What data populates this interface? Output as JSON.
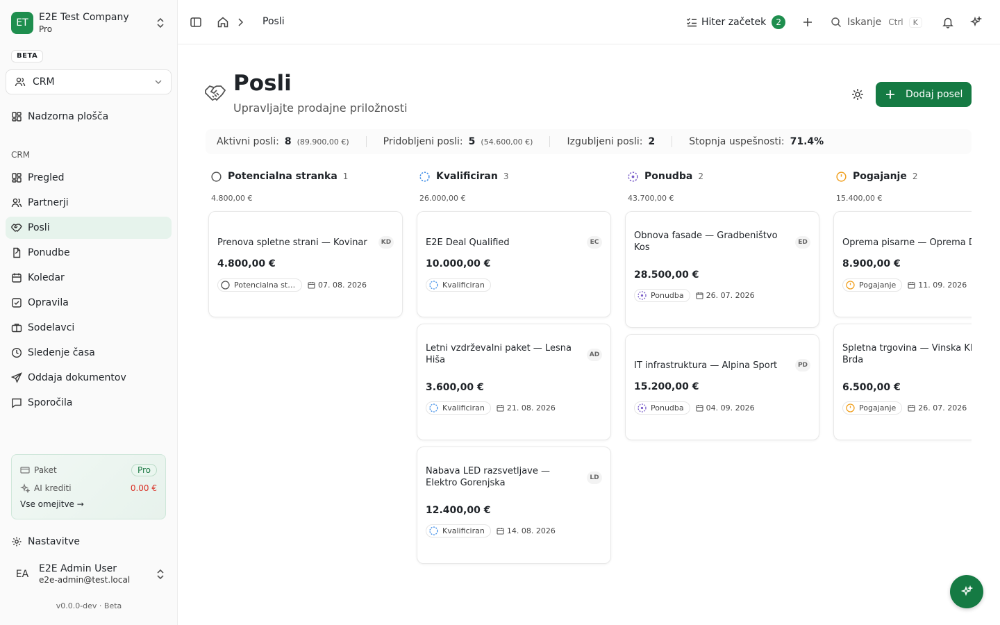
{
  "sidebar": {
    "company": {
      "initials": "ET",
      "name": "E2E Test Company",
      "plan": "Pro"
    },
    "beta": "BETA",
    "module": "CRM",
    "top_items": [
      {
        "label": "Nadzorna plošča",
        "icon": "dashboard-icon"
      }
    ],
    "section_label": "CRM",
    "items": [
      {
        "label": "Pregled",
        "icon": "dashboard-icon"
      },
      {
        "label": "Partnerji",
        "icon": "users-icon"
      },
      {
        "label": "Posli",
        "icon": "handshake-icon"
      },
      {
        "label": "Ponudbe",
        "icon": "document-icon"
      },
      {
        "label": "Koledar",
        "icon": "calendar-icon"
      },
      {
        "label": "Opravila",
        "icon": "checkbox-icon"
      },
      {
        "label": "Sodelavci",
        "icon": "briefcase-icon"
      },
      {
        "label": "Sledenje časa",
        "icon": "clock-icon"
      },
      {
        "label": "Oddaja dokumentov",
        "icon": "send-icon"
      },
      {
        "label": "Sporočila",
        "icon": "message-icon"
      }
    ],
    "plan_card": {
      "package_label": "Paket",
      "package_value": "Pro",
      "credits_label": "AI krediti",
      "credits_value": "0.00 €",
      "link": "Vse omejitve →"
    },
    "settings": "Nastavitve",
    "user": {
      "initials": "EA",
      "name": "E2E Admin User",
      "email": "e2e-admin@test.local"
    },
    "version": "v0.0.0-dev · Beta"
  },
  "topbar": {
    "breadcrumb": "Posli",
    "quick_start": "Hiter začetek",
    "quick_start_count": "2",
    "search_label": "Iskanje",
    "search_kbd1": "Ctrl",
    "search_kbd2": "K"
  },
  "page": {
    "title": "Posli",
    "subtitle": "Upravljajte prodajne priložnosti",
    "add_button": "Dodaj posel"
  },
  "stats": {
    "active_label": "Aktivni posli:",
    "active_value": "8",
    "active_amount": "(89.900,00 €)",
    "won_label": "Pridobljeni posli:",
    "won_value": "5",
    "won_amount": "(54.600,00 €)",
    "lost_label": "Izgubljeni posli:",
    "lost_value": "2",
    "rate_label": "Stopnja uspešnosti:",
    "rate_value": "71.4%"
  },
  "columns": [
    {
      "name": "Potencialna stranka",
      "count": "1",
      "sum": "4.800,00 €",
      "color": "#555555",
      "cards": [
        {
          "title": "Prenova spletne strani — Kovinar",
          "initials": "KD",
          "amount": "4.800,00 €",
          "status": "Potencialna stranka",
          "date": "07. 08. 2026"
        }
      ]
    },
    {
      "name": "Kvalificiran",
      "count": "3",
      "sum": "26.000,00 €",
      "color": "#3b8be6",
      "cards": [
        {
          "title": "E2E Deal Qualified",
          "initials": "EC",
          "amount": "10.000,00 €",
          "status": "Kvalificiran",
          "date": ""
        },
        {
          "title": "Letni vzdrževalni paket — Lesna Hiša",
          "initials": "AD",
          "amount": "3.600,00 €",
          "status": "Kvalificiran",
          "date": "21. 08. 2026"
        },
        {
          "title": "Nabava LED razsvetljave — Elektro Gorenjska",
          "initials": "LD",
          "amount": "12.400,00 €",
          "status": "Kvalificiran",
          "date": "14. 08. 2026"
        }
      ]
    },
    {
      "name": "Ponudba",
      "count": "2",
      "sum": "43.700,00 €",
      "color": "#7b5fc9",
      "cards": [
        {
          "title": "Obnova fasade — Gradbeništvo Kos",
          "initials": "ED",
          "amount": "28.500,00 €",
          "status": "Ponudba",
          "date": "26. 07. 2026"
        },
        {
          "title": "IT infrastruktura — Alpina Sport",
          "initials": "PD",
          "amount": "15.200,00 €",
          "status": "Ponudba",
          "date": "04. 09. 2026"
        }
      ]
    },
    {
      "name": "Pogajanje",
      "count": "2",
      "sum": "15.400,00 €",
      "color": "#f0a020",
      "cards": [
        {
          "title": "Oprema pisarne — Oprema D",
          "initials": "",
          "amount": "8.900,00 €",
          "status": "Pogajanje",
          "date": "11. 09. 2026"
        },
        {
          "title": "Spletna trgovina — Vinska Klet Brda",
          "initials": "",
          "amount": "6.500,00 €",
          "status": "Pogajanje",
          "date": "26. 07. 2026"
        }
      ]
    }
  ]
}
